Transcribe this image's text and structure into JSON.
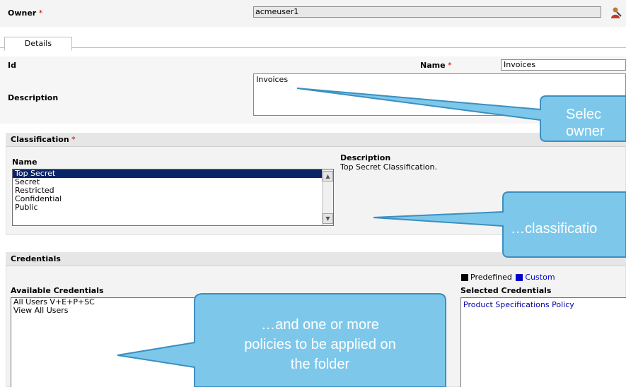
{
  "owner": {
    "label": "Owner",
    "required_mark": "*",
    "value": "acmeuser1",
    "icon": "user-select-icon"
  },
  "tabs": [
    {
      "label": "Details",
      "active": true
    }
  ],
  "details": {
    "id_label": "Id",
    "name_label": "Name",
    "name_required_mark": "*",
    "name_value": "Invoices",
    "description_label": "Description",
    "description_value": "Invoices"
  },
  "classification": {
    "title": "Classification",
    "required_mark": "*",
    "name_col": "Name",
    "desc_col": "Description",
    "options": [
      "Top Secret",
      "Secret",
      "Restricted",
      "Confidential",
      "Public"
    ],
    "selected_index": 0,
    "selected_description": "Top Secret Classification."
  },
  "credentials": {
    "title": "Credentials",
    "legend_predefined": "Predefined",
    "legend_custom": "Custom",
    "legend_predefined_color": "#000000",
    "legend_custom_color": "#0000cc",
    "available_label": "Available Credentials",
    "available": [
      "All Users V+E+P+SC",
      "View All Users"
    ],
    "selected_label": "Selected Credentials",
    "selected": [
      "Product Specifications Policy"
    ]
  },
  "callouts": {
    "c1": "Selec",
    "c1b": "owner",
    "c2": "…classificatio",
    "c3a": "…and one or more",
    "c3b": "policies to be applied on",
    "c3c": "the folder",
    "fill_color": "#7dc8ea",
    "border_color": "#3b8fc0"
  }
}
